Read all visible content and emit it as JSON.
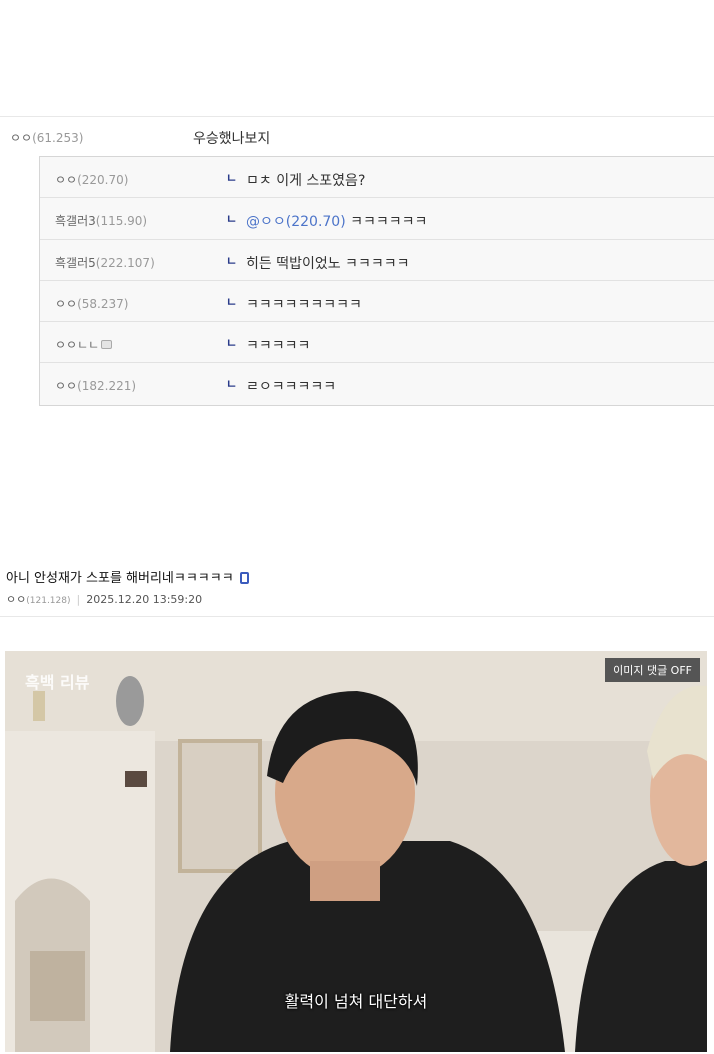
{
  "comments": {
    "main": {
      "nick": "ㅇㅇ",
      "ip": "(61.253)",
      "text": "우승했나보지"
    },
    "replies": [
      {
        "nick": "ㅇㅇ",
        "ip": "(220.70)",
        "icon": "",
        "mention": "",
        "text": "ㅁㅊ 이게 스포였음?"
      },
      {
        "nick": "흑갤러3",
        "ip": "(115.90)",
        "icon": "",
        "mention": "@ㅇㅇ(220.70)",
        "text": " ㅋㅋㅋㅋㅋㅋ"
      },
      {
        "nick": "흑갤러5",
        "ip": "(222.107)",
        "icon": "",
        "mention": "",
        "text": "히든 떡밥이었노 ㅋㅋㅋㅋㅋ"
      },
      {
        "nick": "ㅇㅇ",
        "ip": "(58.237)",
        "icon": "",
        "mention": "",
        "text": "ㅋㅋㅋㅋㅋㅋㅋㅋㅋ"
      },
      {
        "nick": "ㅇㅇㄴㄴ",
        "ip": "",
        "icon": "member-icon",
        "mention": "",
        "text": "ㅋㅋㅋㅋㅋ"
      },
      {
        "nick": "ㅇㅇ",
        "ip": "(182.221)",
        "icon": "",
        "mention": "",
        "text": "ㄹㅇㅋㅋㅋㅋㅋ"
      }
    ],
    "reply_arrow": "ㄴ"
  },
  "post": {
    "title": "아니 안성재가 스포를 해버리네ㅋㅋㅋㅋㅋ",
    "author": "ㅇㅇ",
    "author_ip": "(121.128)",
    "datetime": "2025.12.20 13:59:20",
    "separator": "|"
  },
  "image": {
    "watermark": "흑백 리뷰",
    "toggle_label": "이미지 댓글 OFF",
    "subtitle": "활력이 넘쳐 대단하셔"
  }
}
